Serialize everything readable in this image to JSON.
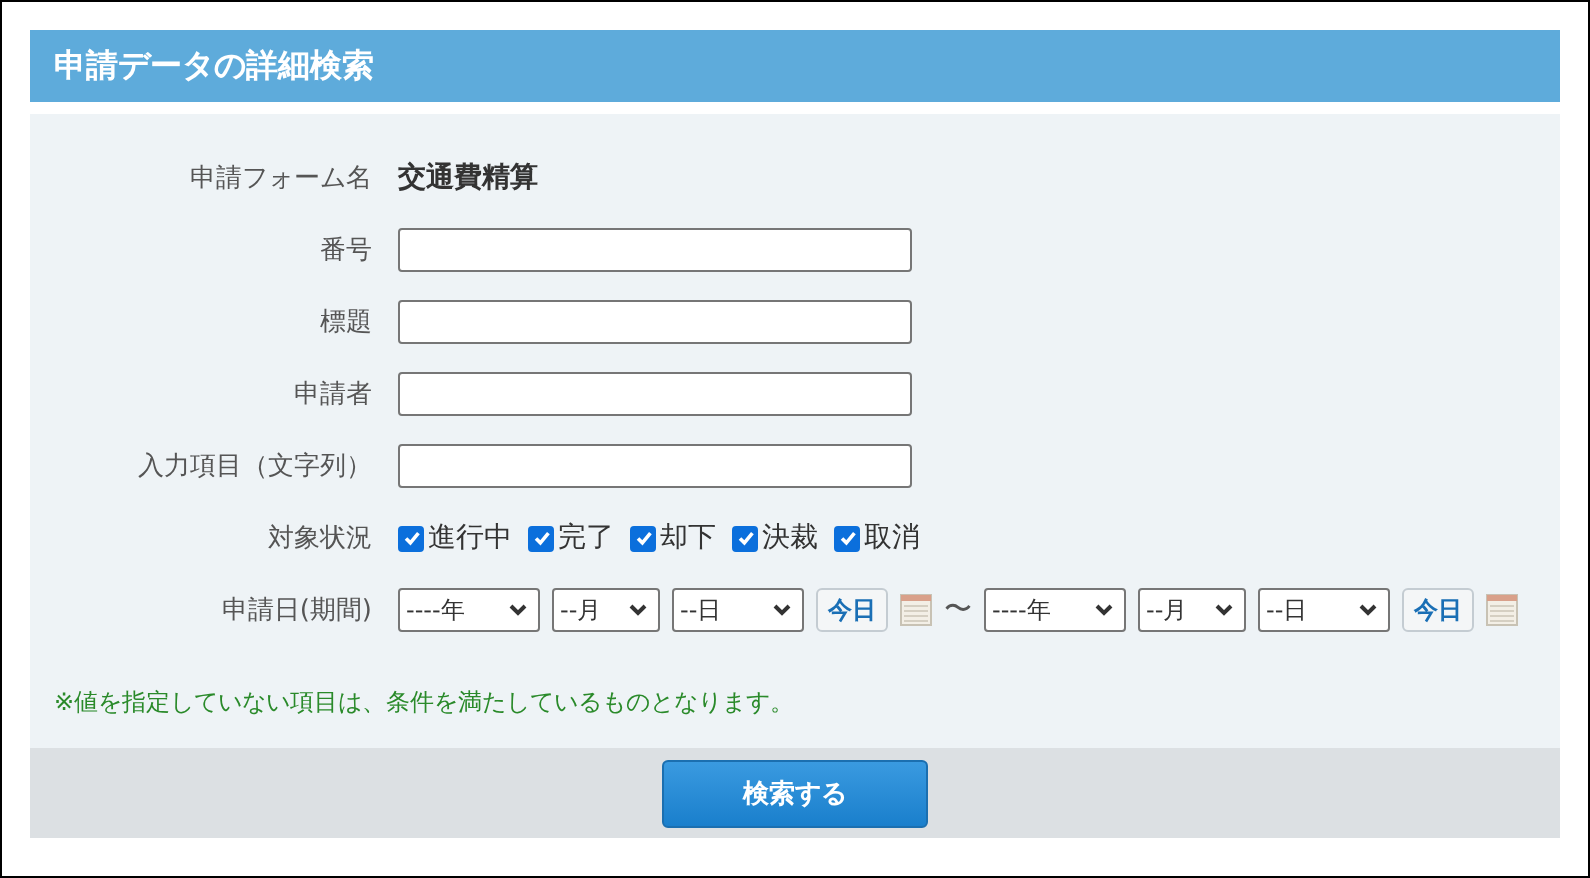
{
  "title": "申請データの詳細検索",
  "fields": [
    {
      "kind": "text",
      "label": "申請フォーム名",
      "value": "交通費精算"
    },
    {
      "kind": "input",
      "label": "番号"
    },
    {
      "kind": "input",
      "label": "標題"
    },
    {
      "kind": "input",
      "label": "申請者"
    },
    {
      "kind": "input",
      "label": "入力項目（文字列）"
    },
    {
      "kind": "checks",
      "label": "対象状況",
      "options": [
        {
          "label": "進行中",
          "checked": true
        },
        {
          "label": "完了",
          "checked": true
        },
        {
          "label": "却下",
          "checked": true
        },
        {
          "label": "決裁",
          "checked": true
        },
        {
          "label": "取消",
          "checked": true
        }
      ]
    },
    {
      "kind": "daterange",
      "label": "申請日(期間)",
      "from": {
        "year": "----年",
        "month": "--月",
        "day": "--日",
        "today": "今日"
      },
      "separator": "〜",
      "to": {
        "year": "----年",
        "month": "--月",
        "day": "--日",
        "today": "今日"
      }
    }
  ],
  "note": "※値を指定していない項目は、条件を満たしているものとなります。",
  "search_button": "検索する"
}
